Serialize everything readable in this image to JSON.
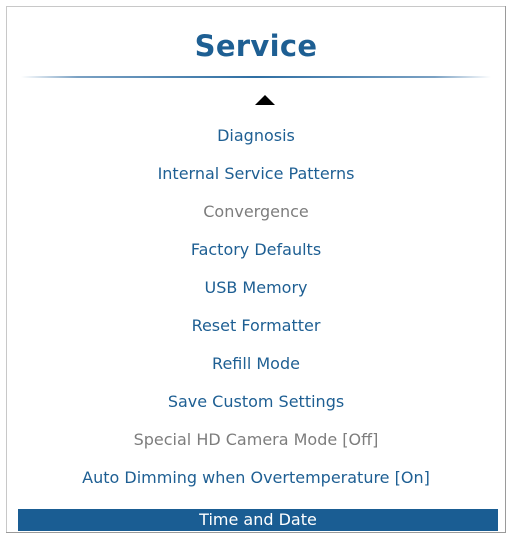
{
  "menu": {
    "title": "Service",
    "scroll_up_icon": "up-triangle-icon",
    "items": [
      {
        "label": "Diagnosis",
        "state": "enabled"
      },
      {
        "label": "Internal Service Patterns",
        "state": "enabled"
      },
      {
        "label": "Convergence",
        "state": "disabled"
      },
      {
        "label": "Factory Defaults",
        "state": "enabled"
      },
      {
        "label": "USB Memory",
        "state": "enabled"
      },
      {
        "label": "Reset Formatter",
        "state": "enabled"
      },
      {
        "label": "Refill Mode",
        "state": "enabled"
      },
      {
        "label": "Save Custom Settings",
        "state": "enabled"
      },
      {
        "label": "Special HD Camera Mode [Off]",
        "state": "disabled"
      },
      {
        "label": "Auto Dimming when Overtemperature [On]",
        "state": "enabled"
      },
      {
        "label": "Time and Date",
        "state": "selected"
      }
    ]
  },
  "colors": {
    "accent": "#1e5f93",
    "disabled_text": "#7d7d7d",
    "selection_bg": "#1a5d93",
    "selection_text": "#ffffff"
  }
}
